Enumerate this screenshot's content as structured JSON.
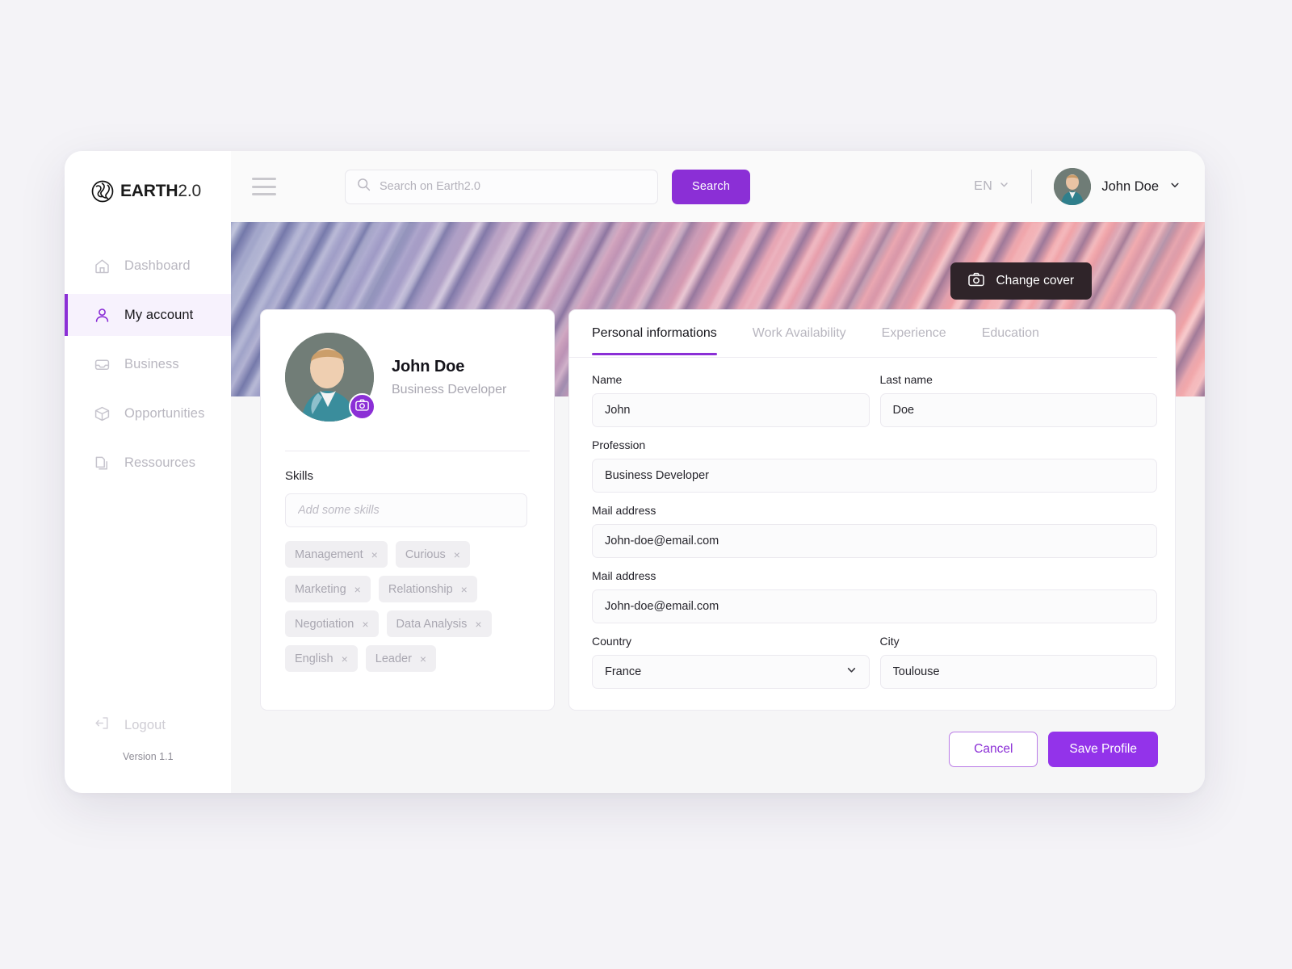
{
  "brand": {
    "name_bold": "EARTH",
    "name_light": "2.0",
    "logo_icon": "globe-icon"
  },
  "sidebar": {
    "items": [
      {
        "label": "Dashboard",
        "icon": "home-icon",
        "active": false
      },
      {
        "label": "My account",
        "icon": "user-icon",
        "active": true
      },
      {
        "label": "Business",
        "icon": "inbox-icon",
        "active": false
      },
      {
        "label": "Opportunities",
        "icon": "box-icon",
        "active": false
      },
      {
        "label": "Ressources",
        "icon": "documents-icon",
        "active": false
      }
    ],
    "logout_label": "Logout",
    "logout_icon": "logout-icon",
    "version": "Version 1.1"
  },
  "topbar": {
    "menu_icon": "hamburger-icon",
    "search": {
      "placeholder": "Search on Earth2.0",
      "value": "",
      "icon": "search-icon",
      "button_label": "Search"
    },
    "language": "EN",
    "language_chevron": "chevron-down-icon",
    "user": {
      "name": "John Doe",
      "avatar": "avatar-john-doe",
      "chevron": "chevron-down-icon"
    }
  },
  "cover": {
    "change_label": "Change cover",
    "camera_icon": "camera-icon"
  },
  "profile": {
    "name": "John Doe",
    "role": "Business Developer",
    "avatar": "avatar-john-doe",
    "change_photo_icon": "camera-icon",
    "skills_label": "Skills",
    "skills_placeholder": "Add some skills",
    "skills_value": "",
    "skills": [
      "Management",
      "Curious",
      "Marketing",
      "Relationship",
      "Negotiation",
      "Data Analysis",
      "English",
      "Leader"
    ],
    "chip_remove": "×"
  },
  "tabs": [
    {
      "label": "Personal informations",
      "active": true
    },
    {
      "label": "Work Availability",
      "active": false
    },
    {
      "label": "Experience",
      "active": false
    },
    {
      "label": "Education",
      "active": false
    }
  ],
  "form": {
    "name": {
      "label": "Name",
      "value": "John"
    },
    "last_name": {
      "label": "Last name",
      "value": "Doe"
    },
    "profession": {
      "label": "Profession",
      "value": "Business Developer"
    },
    "mail_1": {
      "label": "Mail address",
      "value": "John-doe@email.com"
    },
    "mail_2": {
      "label": "Mail address",
      "value": "John-doe@email.com"
    },
    "country": {
      "label": "Country",
      "value": "France"
    },
    "city": {
      "label": "City",
      "value": "Toulouse"
    }
  },
  "actions": {
    "cancel_label": "Cancel",
    "save_label": "Save Profile"
  },
  "colors": {
    "accent": "#8b2fd6",
    "accent_save": "#9333ea",
    "page_bg": "#f4f3f7",
    "panel_bg": "#f6f6f7",
    "cover_dark_btn": "#2f2429"
  }
}
